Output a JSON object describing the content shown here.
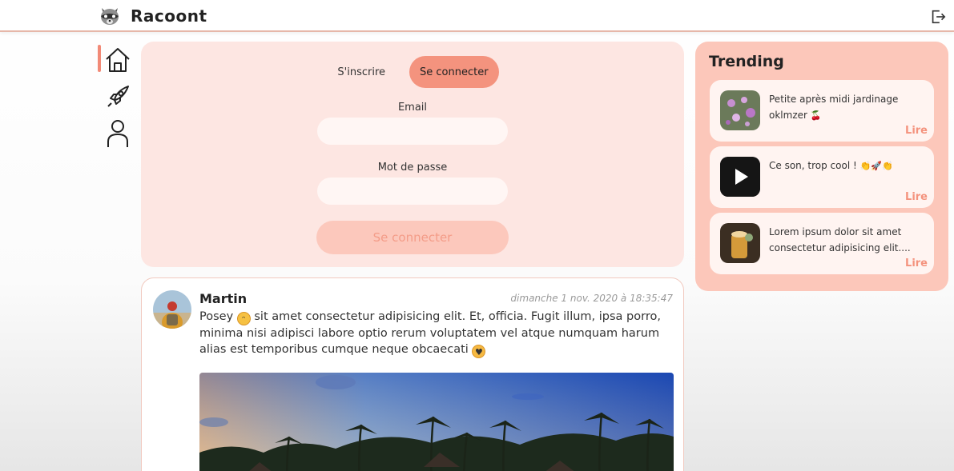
{
  "header": {
    "app_title": "Racoont",
    "logo_icon": "raccoon-logo-icon",
    "logout_icon": "logout-icon"
  },
  "nav": {
    "items": [
      {
        "icon": "home-icon",
        "active": true
      },
      {
        "icon": "rocket-icon",
        "active": false
      },
      {
        "icon": "user-icon",
        "active": false
      }
    ],
    "accent_color": "#f28a77"
  },
  "login": {
    "tabs": [
      {
        "label": "S'inscrire",
        "active": false
      },
      {
        "label": "Se connecter",
        "active": true
      }
    ],
    "email_label": "Email",
    "email_value": "",
    "password_label": "Mot de passe",
    "password_value": "",
    "submit_label": "Se connecter"
  },
  "post": {
    "author": "Martin",
    "date": "dimanche 1 nov. 2020 à 18:35:47",
    "text_part1": "Posey",
    "text_part2": "sit amet consectetur adipisicing elit. Et, officia. Fugit illum, ipsa porro, minima nisi adipisci labore optio rerum voluptatem vel atque numquam harum alias est temporibus cumque neque obcaecati",
    "image": "tropical-resort-photo"
  },
  "trending": {
    "title": "Trending",
    "items": [
      {
        "text": "Petite après midi jardinage oklmzer",
        "emoji": "🍒",
        "read_label": "Lire",
        "thumb": "flowers-photo"
      },
      {
        "text": "Ce son, trop cool !",
        "emoji": "👏🚀👏",
        "read_label": "Lire",
        "thumb": "video-play-icon"
      },
      {
        "text": "Lorem ipsum dolor sit amet consectetur adipisicing elit....",
        "emoji": "",
        "read_label": "Lire",
        "thumb": "drink-photo"
      }
    ]
  },
  "colors": {
    "accent": "#f4937e",
    "card_bg": "#fde6e2",
    "trending_bg": "#fcc7ba"
  }
}
